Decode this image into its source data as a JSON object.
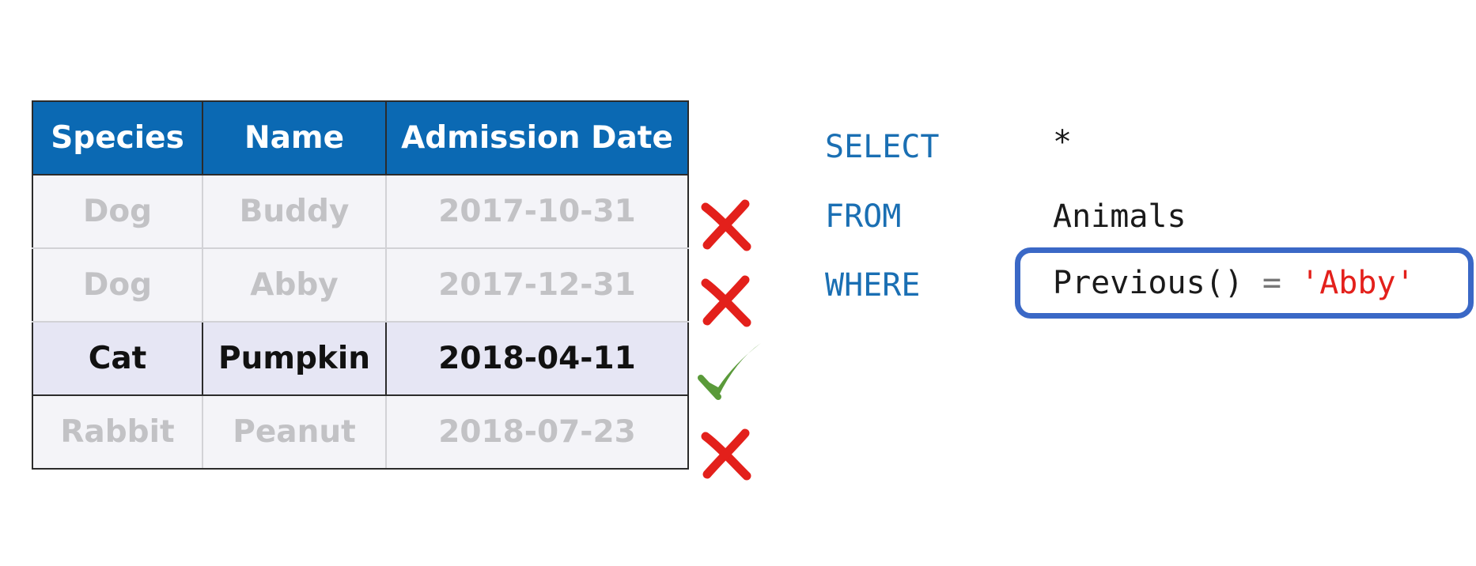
{
  "table": {
    "headers": [
      "Species",
      "Name",
      "Admission Date"
    ],
    "rows": [
      {
        "species": "Dog",
        "name": "Buddy",
        "date": "2017-10-31",
        "status": "excluded"
      },
      {
        "species": "Dog",
        "name": "Abby",
        "date": "2017-12-31",
        "status": "excluded"
      },
      {
        "species": "Cat",
        "name": "Pumpkin",
        "date": "2018-04-11",
        "status": "matched"
      },
      {
        "species": "Rabbit",
        "name": "Peanut",
        "date": "2018-07-23",
        "status": "excluded"
      }
    ]
  },
  "query": {
    "select_kw": "SELECT",
    "select_arg": "*",
    "from_kw": "FROM",
    "from_arg": "Animals",
    "where_kw": "WHERE",
    "where_func": "Previous()",
    "where_op": "=",
    "where_value": "'Abby'"
  },
  "colors": {
    "header_bg": "#0b69b3",
    "keyword": "#1a6fb3",
    "string": "#e3201b",
    "highlight": "#3a68c6",
    "cross_mark": "#e3201b",
    "check_mark": "#5a9a3a"
  },
  "icons": {
    "excluded": "cross-mark-icon",
    "matched": "check-mark-icon"
  }
}
